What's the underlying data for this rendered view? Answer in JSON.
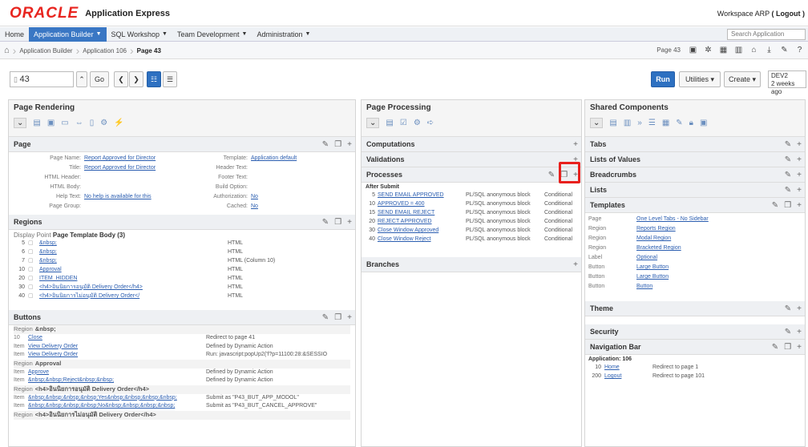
{
  "header": {
    "brand": "ORACLE",
    "app_name": "Application Express",
    "workspace": "Workspace ARP",
    "logout": "( Logout )"
  },
  "menu": {
    "items": [
      {
        "label": "Home",
        "active": false
      },
      {
        "label": "Application Builder",
        "active": true,
        "caret": "▼"
      },
      {
        "label": "SQL Workshop",
        "active": false,
        "caret": "▼"
      },
      {
        "label": "Team Development",
        "active": false,
        "caret": "▼"
      },
      {
        "label": "Administration",
        "active": false,
        "caret": "▼"
      }
    ],
    "search_placeholder": "Search Application"
  },
  "breadcrumbs": {
    "items": [
      "Application Builder",
      "Application 106",
      "Page 43"
    ],
    "page_label": "Page 43"
  },
  "toolbar": {
    "page_number": "43",
    "go": "Go",
    "run": "Run",
    "utilities": "Utilities",
    "create": "Create",
    "dev_label": "DEV2",
    "dev_time": "2 weeks ago"
  },
  "rendering": {
    "title": "Page Rendering",
    "page_section": "Page",
    "page_props_left": [
      {
        "label": "Page Name:",
        "value": "Report Approved for Director"
      },
      {
        "label": "Title:",
        "value": "Report Approved for Director"
      },
      {
        "label": "HTML Header:",
        "value": ""
      },
      {
        "label": "HTML Body:",
        "value": ""
      },
      {
        "label": "Help Text:",
        "value": "No help is available for this"
      },
      {
        "label": "Page Group:",
        "value": ""
      }
    ],
    "page_props_right": [
      {
        "label": "Template:",
        "value": "Application default"
      },
      {
        "label": "Header Text:",
        "value": ""
      },
      {
        "label": "Footer Text:",
        "value": ""
      },
      {
        "label": "Build Option:",
        "value": ""
      },
      {
        "label": "Authorization:",
        "value": "No"
      },
      {
        "label": "Cached:",
        "value": "No"
      }
    ],
    "regions_section": "Regions",
    "display_point_label": "Display Point",
    "display_point": "Page Template Body (3)",
    "regions": [
      {
        "seq": "5",
        "name": "&nbsp;",
        "type": "HTML"
      },
      {
        "seq": "6",
        "name": "&nbsp;",
        "type": "HTML"
      },
      {
        "seq": "7",
        "name": "&nbsp;",
        "type": "HTML (Column 10)"
      },
      {
        "seq": "10",
        "name": "Approval",
        "type": "HTML"
      },
      {
        "seq": "20",
        "name": "ITEM_HIDDEN",
        "type": "HTML"
      },
      {
        "seq": "30",
        "name": "<h4>อินนิยการอนุมัติ Delivery Order</h4>",
        "type": "HTML"
      },
      {
        "seq": "40",
        "name": "<h4>อินนิยการไม่อนุมัติ Delivery Order</",
        "type": "HTML"
      }
    ],
    "buttons_section": "Buttons",
    "button_groups": [
      {
        "region_label": "Region",
        "region": "&nbsp;",
        "rows": [
          {
            "k": "10",
            "v": "Close",
            "r": "Redirect to page 41"
          },
          {
            "k": "Item",
            "v": "View Delivery Order",
            "r": "Defined by Dynamic Action"
          },
          {
            "k": "Item",
            "v": "View Delivery Order",
            "r": "Run: javascript:popUp2('f?p=11100:28:&SESSIO"
          }
        ]
      },
      {
        "region_label": "Region",
        "region": "Approval",
        "rows": [
          {
            "k": "Item",
            "v": "Approve",
            "r": "Defined by Dynamic Action"
          },
          {
            "k": "Item",
            "v": "&nbsp;&nbsp;Reject&nbsp;&nbsp;",
            "r": "Defined by Dynamic Action"
          }
        ]
      },
      {
        "region_label": "Region",
        "region": "<h4>อินนิยการอนุมัติ Delivery Order</h4>",
        "rows": [
          {
            "k": "Item",
            "v": "&nbsp;&nbsp;&nbsp;&nbsp;Yes&nbsp;&nbsp;&nbsp;&nbsp;",
            "r": "Submit as \"P43_BUT_APP_MODOL\""
          },
          {
            "k": "Item",
            "v": "&nbsp;&nbsp;&nbsp;&nbsp;No&nbsp;&nbsp;&nbsp;&nbsp;",
            "r": "Submit as \"P43_BUT_CANCEL_APPROVE\""
          }
        ]
      },
      {
        "region_label": "Region",
        "region": "<h4>อินนิยการไม่อนุมัติ Delivery Order</h4>",
        "rows": []
      }
    ]
  },
  "processing": {
    "title": "Page Processing",
    "computations": "Computations",
    "validations": "Validations",
    "processes": "Processes",
    "after_submit": "After Submit",
    "process_rows": [
      {
        "seq": "5",
        "name": "SEND EMAIL APPROVED",
        "type": "PL/SQL anonymous block",
        "cond": "Conditional"
      },
      {
        "seq": "10",
        "name": "APPROVED = 400",
        "type": "PL/SQL anonymous block",
        "cond": "Conditional"
      },
      {
        "seq": "15",
        "name": "SEND EMAIL REJECT",
        "type": "PL/SQL anonymous block",
        "cond": "Conditional"
      },
      {
        "seq": "20",
        "name": "REJECT APPROVED",
        "type": "PL/SQL anonymous block",
        "cond": "Conditional"
      },
      {
        "seq": "30",
        "name": "Close Window Approved",
        "type": "PL/SQL anonymous block",
        "cond": "Conditional"
      },
      {
        "seq": "40",
        "name": "Close Window Reject",
        "type": "PL/SQL anonymous block",
        "cond": "Conditional"
      }
    ],
    "branches": "Branches"
  },
  "shared": {
    "title": "Shared Components",
    "tabs": "Tabs",
    "lov": "Lists of Values",
    "breadcrumbs": "Breadcrumbs",
    "lists": "Lists",
    "templates": "Templates",
    "template_rows": [
      {
        "k": "Page",
        "v": "One Level Tabs - No Sidebar"
      },
      {
        "k": "Region",
        "v": "Reports Region"
      },
      {
        "k": "Region",
        "v": "Modal Region"
      },
      {
        "k": "Region",
        "v": "Bracketed Region"
      },
      {
        "k": "Label",
        "v": "Optional"
      },
      {
        "k": "Button",
        "v": "Large Button"
      },
      {
        "k": "Button",
        "v": "Large Button"
      },
      {
        "k": "Button",
        "v": "Button"
      }
    ],
    "theme": "Theme",
    "security": "Security",
    "navbar": "Navigation Bar",
    "app_label": "Application: 106",
    "nav_rows": [
      {
        "k": "10",
        "v": "Home",
        "r": "Redirect to page 1"
      },
      {
        "k": "200",
        "v": "Logout",
        "r": "Redirect to page 101"
      }
    ]
  },
  "colors": {
    "accent": "#3a77c4",
    "run": "#2d70c1",
    "oracle_red": "#e8251f",
    "highlight": "#e8201d"
  }
}
